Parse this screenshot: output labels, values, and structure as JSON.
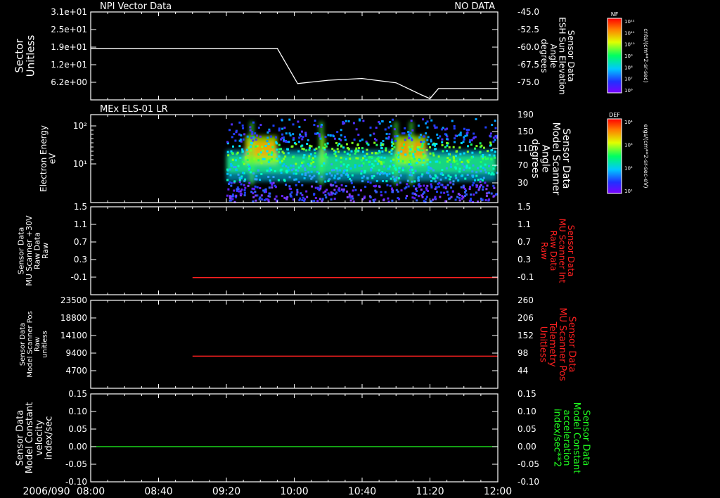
{
  "header": {
    "panel1_title": "NPI Vector Data",
    "panel1_status": "NO DATA",
    "panel2_title": "MEx ELS-01 LR",
    "date_label": "2006/090"
  },
  "time_ticks": [
    "08:00",
    "08:40",
    "09:20",
    "10:00",
    "10:40",
    "11:20",
    "12:00"
  ],
  "colors": {
    "axis": "#ffffff",
    "red": "#ff2020",
    "green": "#20ff20"
  },
  "colorbars": [
    {
      "id": "nf",
      "title": "NF",
      "ticks": [
        "10¹²",
        "10¹¹",
        "10¹⁰",
        "10⁹",
        "10⁸",
        "10⁷",
        "10⁶"
      ],
      "unit": "cnts/(cm**2-sr-sec)"
    },
    {
      "id": "def",
      "title": "DEF",
      "ticks": [
        "10⁴",
        "10³",
        "10²",
        "10¹"
      ],
      "unit": "ergs/(cm**2-sr-sec-eV)"
    }
  ],
  "chart_data": [
    {
      "type": "line",
      "panel": 1,
      "left_label": [
        "Sector",
        "Unitless"
      ],
      "left_ticks": [
        "3.1e+01",
        "2.5e+01",
        "1.9e+01",
        "1.2e+01",
        "6.2e+00"
      ],
      "right_label": [
        "Sensor Data",
        "ESH Sun Elevation",
        "Angle",
        "degrees"
      ],
      "right_ticks": [
        "-45.0",
        "-52.5",
        "-60.0",
        "-67.5",
        "-75.0"
      ],
      "ylim": [
        -80,
        -45
      ],
      "series": [
        {
          "color": "#ffffff",
          "x": [
            "08:00",
            "09:50",
            "10:02",
            "10:20",
            "10:40",
            "11:00",
            "11:15",
            "11:20",
            "11:25",
            "12:00"
          ],
          "values": [
            -59.5,
            -59.5,
            -73.5,
            -72.2,
            -71.5,
            -73.2,
            -78.0,
            -79.5,
            -75.5,
            -75.5
          ]
        }
      ]
    },
    {
      "type": "heatmap",
      "panel": 2,
      "left_label": [
        "Electron Energy",
        "eV"
      ],
      "left_ticks": [
        "10²",
        "10¹"
      ],
      "right_label": [
        "Sensor Data",
        "Model Scanner",
        "Angle",
        "degrees"
      ],
      "right_ticks": [
        "190",
        "150",
        "110",
        "70",
        "30"
      ],
      "data_start": "09:20",
      "data_end": "12:00"
    },
    {
      "type": "line",
      "panel": 3,
      "left_label": [
        "Sensor Data",
        "MU Scanner +30V",
        "Raw Data",
        "Raw"
      ],
      "left_ticks": [
        "1.5",
        "1.1",
        "0.7",
        "0.3",
        "-0.1"
      ],
      "right_label": [
        "Sensor Data",
        "MU Scanner Int",
        "Raw Data",
        "Raw"
      ],
      "right_ticks": [
        "1.5",
        "1.1",
        "0.7",
        "0.3",
        "-0.1"
      ],
      "ylim": [
        -0.3,
        1.5
      ],
      "series": [
        {
          "color": "#ff2020",
          "x": [
            "09:00",
            "12:00"
          ],
          "values": [
            0.05,
            0.05
          ]
        }
      ]
    },
    {
      "type": "line",
      "panel": 4,
      "left_label": [
        "Sensor Data",
        "Model Scanner Pos",
        "Raw",
        "unitless"
      ],
      "left_ticks": [
        "23500",
        "18800",
        "14100",
        "9400",
        "4700"
      ],
      "right_label": [
        "Sensor Data",
        "MU Scanner Pos",
        "Telemetry",
        "Unitless"
      ],
      "right_ticks": [
        "260",
        "206",
        "152",
        "98",
        "44"
      ],
      "ylim": [
        0,
        23500
      ],
      "series": [
        {
          "color": "#ff2020",
          "x": [
            "09:00",
            "12:00"
          ],
          "values": [
            8600,
            8600
          ]
        }
      ]
    },
    {
      "type": "line",
      "panel": 5,
      "left_label": [
        "Sensor Data",
        "Model Constant",
        "velocity",
        "index/sec"
      ],
      "left_ticks": [
        "0.15",
        "0.10",
        "0.05",
        "0.00",
        "-0.05",
        "-0.10"
      ],
      "right_label": [
        "Sensor Data",
        "Model Constant",
        "acceleration",
        "index/sec**2"
      ],
      "right_ticks": [
        "0.15",
        "0.10",
        "0.05",
        "0.00",
        "-0.05",
        "-0.10"
      ],
      "ylim": [
        -0.1,
        0.15
      ],
      "series": [
        {
          "color": "#20ff20",
          "x": [
            "08:00",
            "12:00"
          ],
          "values": [
            0.0,
            0.0
          ]
        }
      ]
    }
  ]
}
